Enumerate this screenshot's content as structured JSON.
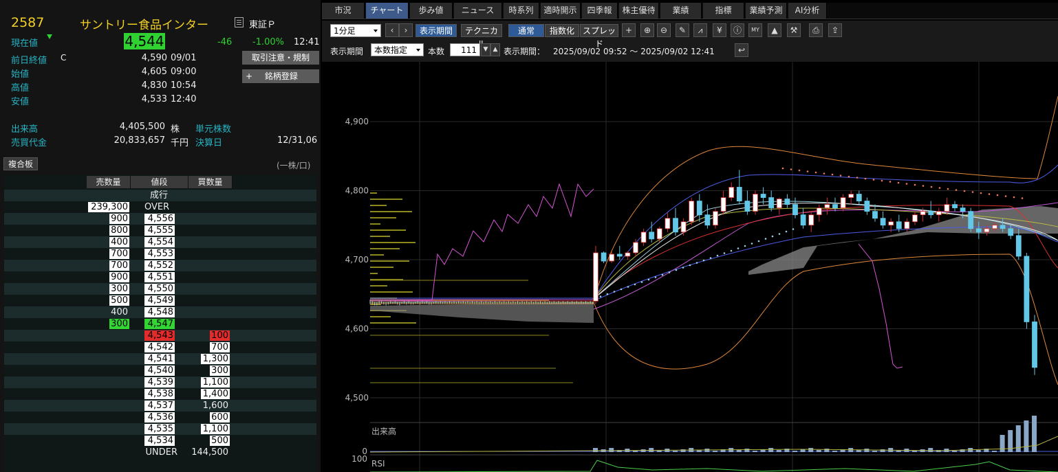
{
  "stock": {
    "code": "2587",
    "name": "サントリー食品インター",
    "market": "東証Ｐ",
    "current_label": "現在値",
    "current_price": "4,544",
    "change": "-46",
    "change_pct": "-1.00%",
    "current_time": "12:41",
    "prev_close_label": "前日終値",
    "prev_close_flag": "C",
    "prev_close": "4,590",
    "prev_close_date": "09/01",
    "open_label": "始値",
    "open": "4,605",
    "open_time": "09:00",
    "high_label": "高値",
    "high": "4,830",
    "high_time": "10:54",
    "low_label": "安値",
    "low": "4,533",
    "low_time": "12:40",
    "volume_label": "出来高",
    "volume": "4,405,500",
    "volume_unit": "株",
    "turnover_label": "売買代金",
    "turnover": "20,833,657",
    "turnover_unit": "千円",
    "unit_shares_label": "単元株数",
    "settlement_label": "決算日",
    "settlement": "12/31,06"
  },
  "buttons": {
    "trade_notice": "取引注意・規制",
    "register": "銘柄登録",
    "register_plus": "+"
  },
  "board": {
    "title": "複合板",
    "unit_note": "(一株/口)",
    "headers": [
      "売数量",
      "値段",
      "買数量"
    ],
    "market_order": "成行",
    "over_qty": "239,300",
    "over_label": "OVER",
    "asks": [
      {
        "qty": "900",
        "price": "4,556"
      },
      {
        "qty": "800",
        "price": "4,555"
      },
      {
        "qty": "400",
        "price": "4,554"
      },
      {
        "qty": "700",
        "price": "4,553"
      },
      {
        "qty": "700",
        "price": "4,552"
      },
      {
        "qty": "900",
        "price": "4,551"
      },
      {
        "qty": "300",
        "price": "4,550"
      },
      {
        "qty": "500",
        "price": "4,549"
      },
      {
        "qty": "400",
        "price": "4,548"
      },
      {
        "qty": "300",
        "price": "4,547"
      }
    ],
    "bids": [
      {
        "price": "4,543",
        "qty": "100"
      },
      {
        "price": "4,542",
        "qty": "700"
      },
      {
        "price": "4,541",
        "qty": "1,300"
      },
      {
        "price": "4,540",
        "qty": "300"
      },
      {
        "price": "4,539",
        "qty": "1,100"
      },
      {
        "price": "4,538",
        "qty": "1,400"
      },
      {
        "price": "4,537",
        "qty": "1,600"
      },
      {
        "price": "4,536",
        "qty": "600"
      },
      {
        "price": "4,535",
        "qty": "1,100"
      },
      {
        "price": "4,534",
        "qty": "500"
      }
    ],
    "under_label": "UNDER",
    "under_qty": "144,500"
  },
  "tabs": [
    "市況",
    "チャート",
    "歩み値",
    "ニュース",
    "時系列",
    "適時開示",
    "四季報",
    "株主優待",
    "業績",
    "指標",
    "業績予測",
    "AI分析"
  ],
  "active_tab": "チャート",
  "toolbar": {
    "interval": "1分足",
    "display_period_btn": "表示期間",
    "technical_btn": "テクニカル",
    "normal_btn": "通常",
    "indexed_btn": "指数化",
    "spread_btn": "スプレッド",
    "period_label": "表示期間",
    "period_mode": "本数指定",
    "count_label": "本数",
    "count": "111",
    "range_label": "表示期間：",
    "range": "2025/09/02 09:52 ～ 2025/09/02 12:41",
    "icons": [
      "crosshair-icon",
      "zoom-in-icon",
      "zoom-out-icon",
      "pencil-icon",
      "trend-icon",
      "yen-icon",
      "info-icon",
      "my-icon",
      "volume-profile-icon",
      "wrench-icon",
      "print-icon",
      "export-icon"
    ]
  },
  "chart_data": {
    "type": "candlestick",
    "y_ticks": [
      "4,900",
      "4,800",
      "4,700",
      "4,600",
      "4,500"
    ],
    "ylim": [
      4460,
      4960
    ],
    "volume_label": "出来高",
    "volume_tick": "0",
    "rsi_label": "RSI",
    "rsi_tick": "100",
    "candles": [
      [
        4640,
        4642,
        4636,
        4638
      ],
      [
        4638,
        4640,
        4635,
        4637
      ],
      [
        4637,
        4639,
        4634,
        4636
      ],
      [
        4636,
        4638,
        4634,
        4637
      ],
      [
        4637,
        4640,
        4635,
        4638
      ],
      [
        4638,
        4640,
        4636,
        4637
      ],
      [
        4637,
        4639,
        4635,
        4636
      ],
      [
        4636,
        4638,
        4634,
        4637
      ],
      [
        4637,
        4639,
        4635,
        4638
      ],
      [
        4638,
        4640,
        4636,
        4637
      ],
      [
        4637,
        4639,
        4636,
        4638
      ],
      [
        4638,
        4640,
        4636,
        4637
      ],
      [
        4637,
        4639,
        4635,
        4636
      ],
      [
        4636,
        4638,
        4634,
        4637
      ],
      [
        4637,
        4639,
        4636,
        4638
      ],
      [
        4638,
        4640,
        4636,
        4637
      ],
      [
        4637,
        4639,
        4635,
        4638
      ],
      [
        4638,
        4640,
        4636,
        4637
      ],
      [
        4637,
        4639,
        4635,
        4636
      ],
      [
        4636,
        4638,
        4635,
        4637
      ],
      [
        4637,
        4639,
        4636,
        4638
      ],
      [
        4638,
        4640,
        4636,
        4637
      ],
      [
        4637,
        4639,
        4635,
        4638
      ],
      [
        4638,
        4640,
        4636,
        4637
      ],
      [
        4637,
        4639,
        4636,
        4638
      ],
      [
        4638,
        4640,
        4636,
        4637
      ],
      [
        4637,
        4639,
        4635,
        4636
      ],
      [
        4636,
        4638,
        4635,
        4637
      ],
      [
        4637,
        4639,
        4636,
        4638
      ],
      [
        4638,
        4640,
        4636,
        4637
      ],
      [
        4637,
        4639,
        4636,
        4638
      ],
      [
        4638,
        4640,
        4636,
        4637
      ],
      [
        4637,
        4639,
        4636,
        4638
      ],
      [
        4638,
        4640,
        4636,
        4637
      ],
      [
        4637,
        4639,
        4636,
        4638
      ],
      [
        4638,
        4640,
        4636,
        4637
      ],
      [
        4637,
        4639,
        4636,
        4638
      ],
      [
        4638,
        4640,
        4636,
        4637
      ],
      [
        4637,
        4639,
        4636,
        4638
      ],
      [
        4638,
        4640,
        4636,
        4637
      ],
      [
        4637,
        4639,
        4636,
        4638
      ],
      [
        4638,
        4640,
        4636,
        4637
      ],
      [
        4637,
        4639,
        4636,
        4638
      ],
      [
        4638,
        4640,
        4636,
        4637
      ],
      [
        4637,
        4639,
        4636,
        4638
      ],
      [
        4638,
        4640,
        4636,
        4637
      ],
      [
        4637,
        4639,
        4636,
        4638
      ],
      [
        4638,
        4640,
        4636,
        4637
      ],
      [
        4637,
        4639,
        4636,
        4638
      ],
      [
        4638,
        4640,
        4636,
        4637
      ],
      [
        4637,
        4639,
        4636,
        4638
      ],
      [
        4638,
        4640,
        4636,
        4637
      ],
      [
        4637,
        4639,
        4636,
        4638
      ],
      [
        4638,
        4640,
        4636,
        4637
      ],
      [
        4637,
        4639,
        4636,
        4638
      ],
      [
        4638,
        4640,
        4636,
        4637
      ],
      [
        4637,
        4639,
        4636,
        4638
      ],
      [
        4638,
        4640,
        4636,
        4637
      ],
      [
        4637,
        4639,
        4636,
        4638
      ],
      [
        4638,
        4640,
        4636,
        4637
      ],
      [
        4637,
        4639,
        4636,
        4638
      ],
      [
        4638,
        4640,
        4636,
        4637
      ],
      [
        4637,
        4639,
        4636,
        4638
      ],
      [
        4638,
        4640,
        4636,
        4637
      ],
      [
        4637,
        4639,
        4636,
        4638
      ],
      [
        4638,
        4640,
        4636,
        4637
      ],
      [
        4637,
        4639,
        4636,
        4638
      ],
      [
        4638,
        4640,
        4636,
        4637
      ],
      [
        4637,
        4639,
        4636,
        4638
      ],
      [
        4638,
        4640,
        4636,
        4637
      ],
      [
        4637,
        4639,
        4636,
        4638
      ],
      [
        4638,
        4640,
        4636,
        4637
      ],
      [
        4637,
        4639,
        4636,
        4638
      ],
      [
        4638,
        4640,
        4636,
        4637
      ],
      [
        4637,
        4639,
        4636,
        4638
      ],
      [
        4638,
        4640,
        4636,
        4637
      ],
      [
        4637,
        4639,
        4636,
        4638
      ],
      [
        4638,
        4640,
        4636,
        4637
      ],
      [
        4637,
        4639,
        4636,
        4638
      ],
      [
        4638,
        4640,
        4636,
        4637
      ],
      [
        4637,
        4639,
        4636,
        4638
      ],
      [
        4638,
        4640,
        4636,
        4637
      ],
      [
        4637,
        4639,
        4636,
        4638
      ],
      [
        4638,
        4640,
        4636,
        4637
      ],
      [
        4637,
        4639,
        4636,
        4638
      ],
      [
        4638,
        4640,
        4636,
        4637
      ],
      [
        4637,
        4639,
        4636,
        4638
      ],
      [
        4638,
        4640,
        4636,
        4637
      ],
      [
        4637,
        4639,
        4636,
        4638
      ],
      [
        4638,
        4640,
        4636,
        4637
      ],
      [
        4637,
        4639,
        4636,
        4638
      ],
      [
        4638,
        4640,
        4636,
        4637
      ],
      [
        4637,
        4639,
        4636,
        4638
      ],
      [
        4638,
        4640,
        4636,
        4637
      ],
      [
        4637,
        4639,
        4636,
        4638
      ],
      [
        4638,
        4640,
        4636,
        4637
      ],
      [
        4637,
        4639,
        4636,
        4638
      ],
      [
        4638,
        4640,
        4636,
        4637
      ],
      [
        4637,
        4639,
        4636,
        4638
      ]
    ],
    "live_candles": [
      [
        4640,
        4720,
        4636,
        4710
      ],
      [
        4710,
        4712,
        4695,
        4698
      ],
      [
        4698,
        4712,
        4695,
        4708
      ],
      [
        4708,
        4720,
        4700,
        4705
      ],
      [
        4705,
        4712,
        4700,
        4710
      ],
      [
        4710,
        4730,
        4705,
        4725
      ],
      [
        4725,
        4745,
        4720,
        4740
      ],
      [
        4740,
        4755,
        4725,
        4730
      ],
      [
        4730,
        4748,
        4725,
        4745
      ],
      [
        4745,
        4768,
        4740,
        4760
      ],
      [
        4760,
        4775,
        4735,
        4740
      ],
      [
        4740,
        4760,
        4735,
        4755
      ],
      [
        4755,
        4790,
        4750,
        4785
      ],
      [
        4785,
        4795,
        4755,
        4765
      ],
      [
        4765,
        4780,
        4745,
        4750
      ],
      [
        4750,
        4775,
        4745,
        4770
      ],
      [
        4770,
        4800,
        4765,
        4790
      ],
      [
        4790,
        4812,
        4785,
        4805
      ],
      [
        4805,
        4830,
        4780,
        4785
      ],
      [
        4785,
        4800,
        4765,
        4770
      ],
      [
        4770,
        4800,
        4765,
        4795
      ],
      [
        4795,
        4805,
        4780,
        4790
      ],
      [
        4790,
        4800,
        4770,
        4775
      ],
      [
        4775,
        4790,
        4765,
        4788
      ],
      [
        4788,
        4795,
        4775,
        4780
      ],
      [
        4780,
        4790,
        4760,
        4765
      ],
      [
        4765,
        4775,
        4745,
        4750
      ],
      [
        4750,
        4770,
        4740,
        4765
      ],
      [
        4765,
        4780,
        4755,
        4775
      ],
      [
        4775,
        4790,
        4765,
        4780
      ],
      [
        4780,
        4790,
        4770,
        4775
      ],
      [
        4775,
        4795,
        4770,
        4790
      ],
      [
        4790,
        4800,
        4780,
        4795
      ],
      [
        4795,
        4800,
        4780,
        4785
      ],
      [
        4785,
        4790,
        4765,
        4770
      ],
      [
        4770,
        4780,
        4755,
        4760
      ],
      [
        4760,
        4770,
        4745,
        4750
      ],
      [
        4750,
        4760,
        4740,
        4755
      ],
      [
        4755,
        4765,
        4740,
        4745
      ],
      [
        4745,
        4760,
        4740,
        4755
      ],
      [
        4755,
        4770,
        4750,
        4765
      ],
      [
        4765,
        4775,
        4755,
        4770
      ],
      [
        4770,
        4785,
        4760,
        4765
      ],
      [
        4765,
        4775,
        4755,
        4770
      ],
      [
        4770,
        4790,
        4765,
        4780
      ],
      [
        4780,
        4785,
        4770,
        4775
      ],
      [
        4775,
        4780,
        4760,
        4770
      ],
      [
        4770,
        4775,
        4740,
        4745
      ],
      [
        4745,
        4755,
        4730,
        4740
      ],
      [
        4740,
        4750,
        4735,
        4745
      ],
      [
        4745,
        4755,
        4740,
        4750
      ],
      [
        4750,
        4760,
        4740,
        4745
      ],
      [
        4745,
        4750,
        4730,
        4735
      ],
      [
        4735,
        4745,
        4700,
        4705
      ],
      [
        4705,
        4710,
        4600,
        4610
      ],
      [
        4610,
        4620,
        4533,
        4544
      ]
    ]
  }
}
